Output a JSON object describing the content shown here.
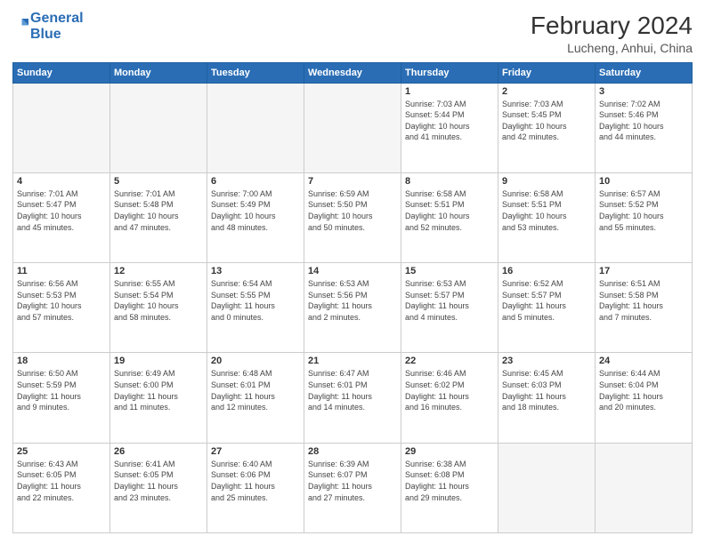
{
  "logo": {
    "line1": "General",
    "line2": "Blue"
  },
  "title": "February 2024",
  "subtitle": "Lucheng, Anhui, China",
  "days_header": [
    "Sunday",
    "Monday",
    "Tuesday",
    "Wednesday",
    "Thursday",
    "Friday",
    "Saturday"
  ],
  "weeks": [
    [
      {
        "day": "",
        "info": ""
      },
      {
        "day": "",
        "info": ""
      },
      {
        "day": "",
        "info": ""
      },
      {
        "day": "",
        "info": ""
      },
      {
        "day": "1",
        "info": "Sunrise: 7:03 AM\nSunset: 5:44 PM\nDaylight: 10 hours\nand 41 minutes."
      },
      {
        "day": "2",
        "info": "Sunrise: 7:03 AM\nSunset: 5:45 PM\nDaylight: 10 hours\nand 42 minutes."
      },
      {
        "day": "3",
        "info": "Sunrise: 7:02 AM\nSunset: 5:46 PM\nDaylight: 10 hours\nand 44 minutes."
      }
    ],
    [
      {
        "day": "4",
        "info": "Sunrise: 7:01 AM\nSunset: 5:47 PM\nDaylight: 10 hours\nand 45 minutes."
      },
      {
        "day": "5",
        "info": "Sunrise: 7:01 AM\nSunset: 5:48 PM\nDaylight: 10 hours\nand 47 minutes."
      },
      {
        "day": "6",
        "info": "Sunrise: 7:00 AM\nSunset: 5:49 PM\nDaylight: 10 hours\nand 48 minutes."
      },
      {
        "day": "7",
        "info": "Sunrise: 6:59 AM\nSunset: 5:50 PM\nDaylight: 10 hours\nand 50 minutes."
      },
      {
        "day": "8",
        "info": "Sunrise: 6:58 AM\nSunset: 5:51 PM\nDaylight: 10 hours\nand 52 minutes."
      },
      {
        "day": "9",
        "info": "Sunrise: 6:58 AM\nSunset: 5:51 PM\nDaylight: 10 hours\nand 53 minutes."
      },
      {
        "day": "10",
        "info": "Sunrise: 6:57 AM\nSunset: 5:52 PM\nDaylight: 10 hours\nand 55 minutes."
      }
    ],
    [
      {
        "day": "11",
        "info": "Sunrise: 6:56 AM\nSunset: 5:53 PM\nDaylight: 10 hours\nand 57 minutes."
      },
      {
        "day": "12",
        "info": "Sunrise: 6:55 AM\nSunset: 5:54 PM\nDaylight: 10 hours\nand 58 minutes."
      },
      {
        "day": "13",
        "info": "Sunrise: 6:54 AM\nSunset: 5:55 PM\nDaylight: 11 hours\nand 0 minutes."
      },
      {
        "day": "14",
        "info": "Sunrise: 6:53 AM\nSunset: 5:56 PM\nDaylight: 11 hours\nand 2 minutes."
      },
      {
        "day": "15",
        "info": "Sunrise: 6:53 AM\nSunset: 5:57 PM\nDaylight: 11 hours\nand 4 minutes."
      },
      {
        "day": "16",
        "info": "Sunrise: 6:52 AM\nSunset: 5:57 PM\nDaylight: 11 hours\nand 5 minutes."
      },
      {
        "day": "17",
        "info": "Sunrise: 6:51 AM\nSunset: 5:58 PM\nDaylight: 11 hours\nand 7 minutes."
      }
    ],
    [
      {
        "day": "18",
        "info": "Sunrise: 6:50 AM\nSunset: 5:59 PM\nDaylight: 11 hours\nand 9 minutes."
      },
      {
        "day": "19",
        "info": "Sunrise: 6:49 AM\nSunset: 6:00 PM\nDaylight: 11 hours\nand 11 minutes."
      },
      {
        "day": "20",
        "info": "Sunrise: 6:48 AM\nSunset: 6:01 PM\nDaylight: 11 hours\nand 12 minutes."
      },
      {
        "day": "21",
        "info": "Sunrise: 6:47 AM\nSunset: 6:01 PM\nDaylight: 11 hours\nand 14 minutes."
      },
      {
        "day": "22",
        "info": "Sunrise: 6:46 AM\nSunset: 6:02 PM\nDaylight: 11 hours\nand 16 minutes."
      },
      {
        "day": "23",
        "info": "Sunrise: 6:45 AM\nSunset: 6:03 PM\nDaylight: 11 hours\nand 18 minutes."
      },
      {
        "day": "24",
        "info": "Sunrise: 6:44 AM\nSunset: 6:04 PM\nDaylight: 11 hours\nand 20 minutes."
      }
    ],
    [
      {
        "day": "25",
        "info": "Sunrise: 6:43 AM\nSunset: 6:05 PM\nDaylight: 11 hours\nand 22 minutes."
      },
      {
        "day": "26",
        "info": "Sunrise: 6:41 AM\nSunset: 6:05 PM\nDaylight: 11 hours\nand 23 minutes."
      },
      {
        "day": "27",
        "info": "Sunrise: 6:40 AM\nSunset: 6:06 PM\nDaylight: 11 hours\nand 25 minutes."
      },
      {
        "day": "28",
        "info": "Sunrise: 6:39 AM\nSunset: 6:07 PM\nDaylight: 11 hours\nand 27 minutes."
      },
      {
        "day": "29",
        "info": "Sunrise: 6:38 AM\nSunset: 6:08 PM\nDaylight: 11 hours\nand 29 minutes."
      },
      {
        "day": "",
        "info": ""
      },
      {
        "day": "",
        "info": ""
      }
    ]
  ]
}
